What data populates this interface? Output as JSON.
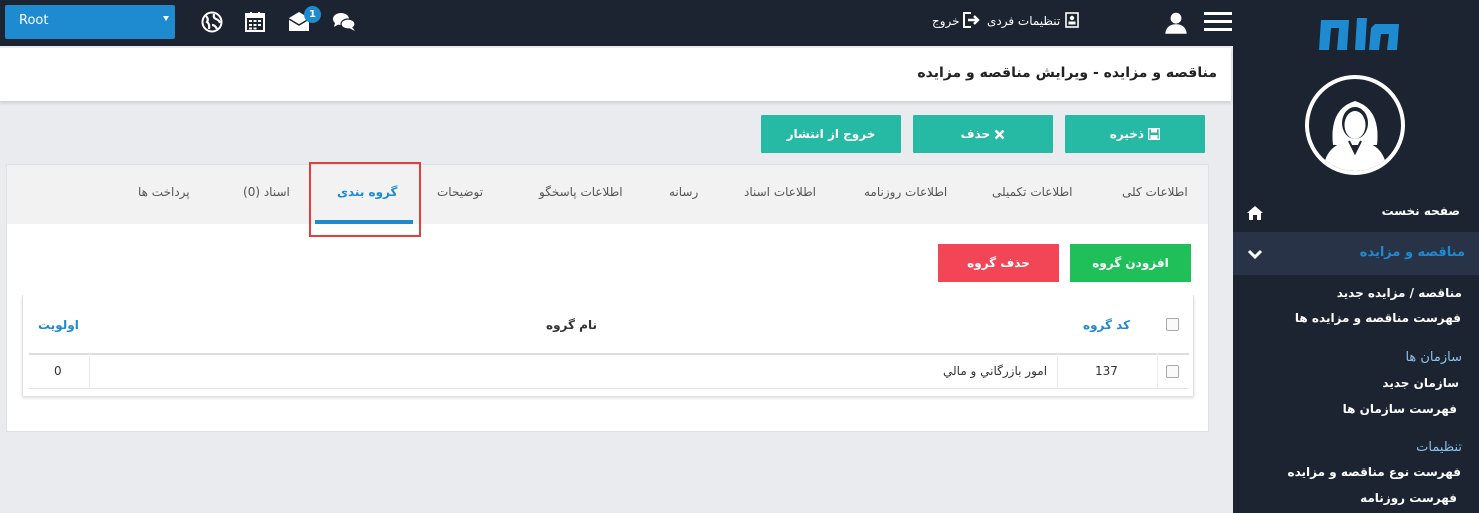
{
  "topbar": {
    "root_select": "Root",
    "badge_count": "1",
    "personal_settings": "تنظیمات فردی",
    "logout": "خروج",
    "icons": [
      "globe-icon",
      "calendar-icon",
      "mail-icon",
      "chat-icon",
      "profile-card-icon",
      "logout-icon",
      "user-icon",
      "hamburger-menu-icon"
    ]
  },
  "sidebar": {
    "home": "صفحه نخست",
    "active_section": "مناقصه و مزایده",
    "items": [
      {
        "label": "مناقصه / مزایده جدید"
      },
      {
        "label": "فهرست مناقصه و مزایده ها"
      }
    ],
    "org_heading": "سازمان ها",
    "org_items": [
      {
        "label": "سازمان جدید"
      },
      {
        "label": "فهرست سازمان ها"
      }
    ],
    "settings_heading": "تنظیمات",
    "settings_items": [
      {
        "label": "فهرست نوع مناقصه و مزایده"
      },
      {
        "label": "فهرست روزنامه"
      }
    ]
  },
  "header": {
    "title": "مناقصه و مزایده - ویرایش مناقصه و مزایده"
  },
  "actions": {
    "save": "ذخیره",
    "delete": "حذف",
    "unpublish": "خروج از انتشار"
  },
  "tabs": [
    {
      "label": "اطلاعات کلی"
    },
    {
      "label": "اطلاعات تکمیلی"
    },
    {
      "label": "اطلاعات روزنامه"
    },
    {
      "label": "اطلاعات اسناد"
    },
    {
      "label": "رسانه"
    },
    {
      "label": "اطلاعات پاسخگو"
    },
    {
      "label": "توضیحات"
    },
    {
      "label": "گروه بندی"
    },
    {
      "label": "اسناد (0)"
    },
    {
      "label": "پرداخت ها"
    }
  ],
  "active_tab": "گروه بندی",
  "group": {
    "add_button": "افزودن گروه",
    "delete_button": "حذف گروه",
    "columns": {
      "code": "کد گروه",
      "name": "نام گروه",
      "priority": "اولویت"
    },
    "rows": [
      {
        "code": "137",
        "name": "امور بازرگاني و مالي",
        "priority": "0"
      }
    ]
  },
  "colors": {
    "topbar_bg": "#1c2331",
    "accent_blue": "#1e8ad0",
    "teal_button": "#26b9a3",
    "green_button": "#1fc05a",
    "red_button": "#f24556",
    "highlight_border": "#e0403c"
  }
}
